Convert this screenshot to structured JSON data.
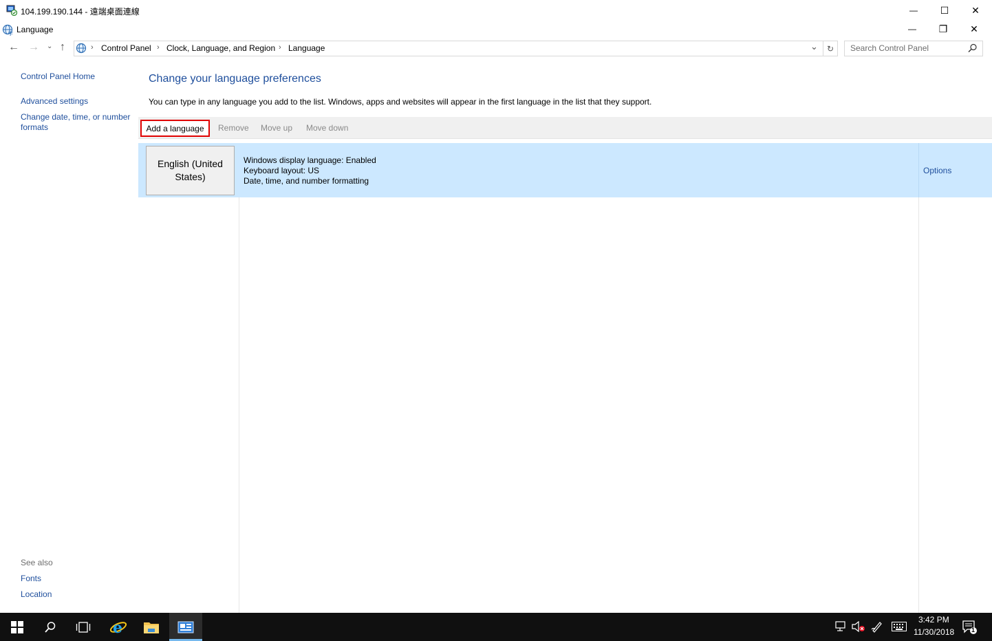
{
  "rdp_window": {
    "title": "104.199.190.144 - 遠端桌面連線",
    "min_glyph": "—",
    "max_glyph": "☐",
    "close_glyph": "✕"
  },
  "window": {
    "title": "Language",
    "min_glyph": "—",
    "restore_glyph": "❐",
    "close_glyph": "✕"
  },
  "address_bar": {
    "breadcrumbs": [
      "Control Panel",
      "Clock, Language, and Region",
      "Language"
    ],
    "separator": "›",
    "refresh_glyph": "↻",
    "dropdown_glyph": "⌄"
  },
  "search": {
    "placeholder": "Search Control Panel"
  },
  "left_pane": {
    "home_link": "Control Panel Home",
    "advanced_link": "Advanced settings",
    "date_link_line1": "Change date, time, or number",
    "date_link_line2": "formats",
    "see_also_label": "See also",
    "fonts_link": "Fonts",
    "location_link": "Location"
  },
  "main": {
    "heading": "Change your language preferences",
    "description": "You can type in any language you add to the list. Windows, apps and websites will appear in the first language in the list that they support.",
    "toolbar": {
      "add": "Add a language",
      "remove": "Remove",
      "move_up": "Move up",
      "move_down": "Move down"
    },
    "languages": [
      {
        "name_line1": "English (United",
        "name_line2": "States)",
        "display_language": "Windows display language: Enabled",
        "keyboard_layout": "Keyboard layout: US",
        "formatting": "Date, time, and number formatting",
        "options_link": "Options"
      }
    ]
  },
  "taskbar": {
    "time": "3:42 PM",
    "date": "11/30/2018",
    "notification_count": "1"
  },
  "colors": {
    "link": "#1e4e9c",
    "selection": "#cce8ff",
    "highlight_border": "#e00000",
    "taskbar": "#101010"
  }
}
